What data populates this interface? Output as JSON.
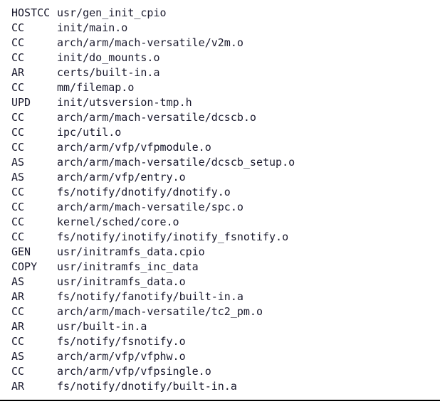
{
  "build_log": [
    {
      "tag": "HOSTCC",
      "path": "usr/gen_init_cpio"
    },
    {
      "tag": "CC",
      "path": "init/main.o"
    },
    {
      "tag": "CC",
      "path": "arch/arm/mach-versatile/v2m.o"
    },
    {
      "tag": "CC",
      "path": "init/do_mounts.o"
    },
    {
      "tag": "AR",
      "path": "certs/built-in.a"
    },
    {
      "tag": "CC",
      "path": "mm/filemap.o"
    },
    {
      "tag": "UPD",
      "path": "init/utsversion-tmp.h"
    },
    {
      "tag": "CC",
      "path": "arch/arm/mach-versatile/dcscb.o"
    },
    {
      "tag": "CC",
      "path": "ipc/util.o"
    },
    {
      "tag": "CC",
      "path": "arch/arm/vfp/vfpmodule.o"
    },
    {
      "tag": "AS",
      "path": "arch/arm/mach-versatile/dcscb_setup.o"
    },
    {
      "tag": "AS",
      "path": "arch/arm/vfp/entry.o"
    },
    {
      "tag": "CC",
      "path": "fs/notify/dnotify/dnotify.o"
    },
    {
      "tag": "CC",
      "path": "arch/arm/mach-versatile/spc.o"
    },
    {
      "tag": "CC",
      "path": "kernel/sched/core.o"
    },
    {
      "tag": "CC",
      "path": "fs/notify/inotify/inotify_fsnotify.o"
    },
    {
      "tag": "GEN",
      "path": "usr/initramfs_data.cpio"
    },
    {
      "tag": "COPY",
      "path": "usr/initramfs_inc_data"
    },
    {
      "tag": "AS",
      "path": "usr/initramfs_data.o"
    },
    {
      "tag": "AR",
      "path": "fs/notify/fanotify/built-in.a"
    },
    {
      "tag": "CC",
      "path": "arch/arm/mach-versatile/tc2_pm.o"
    },
    {
      "tag": "AR",
      "path": "usr/built-in.a"
    },
    {
      "tag": "CC",
      "path": "fs/notify/fsnotify.o"
    },
    {
      "tag": "AS",
      "path": "arch/arm/vfp/vfphw.o"
    },
    {
      "tag": "CC",
      "path": "arch/arm/vfp/vfpsingle.o"
    },
    {
      "tag": "AR",
      "path": "fs/notify/dnotify/built-in.a"
    }
  ]
}
